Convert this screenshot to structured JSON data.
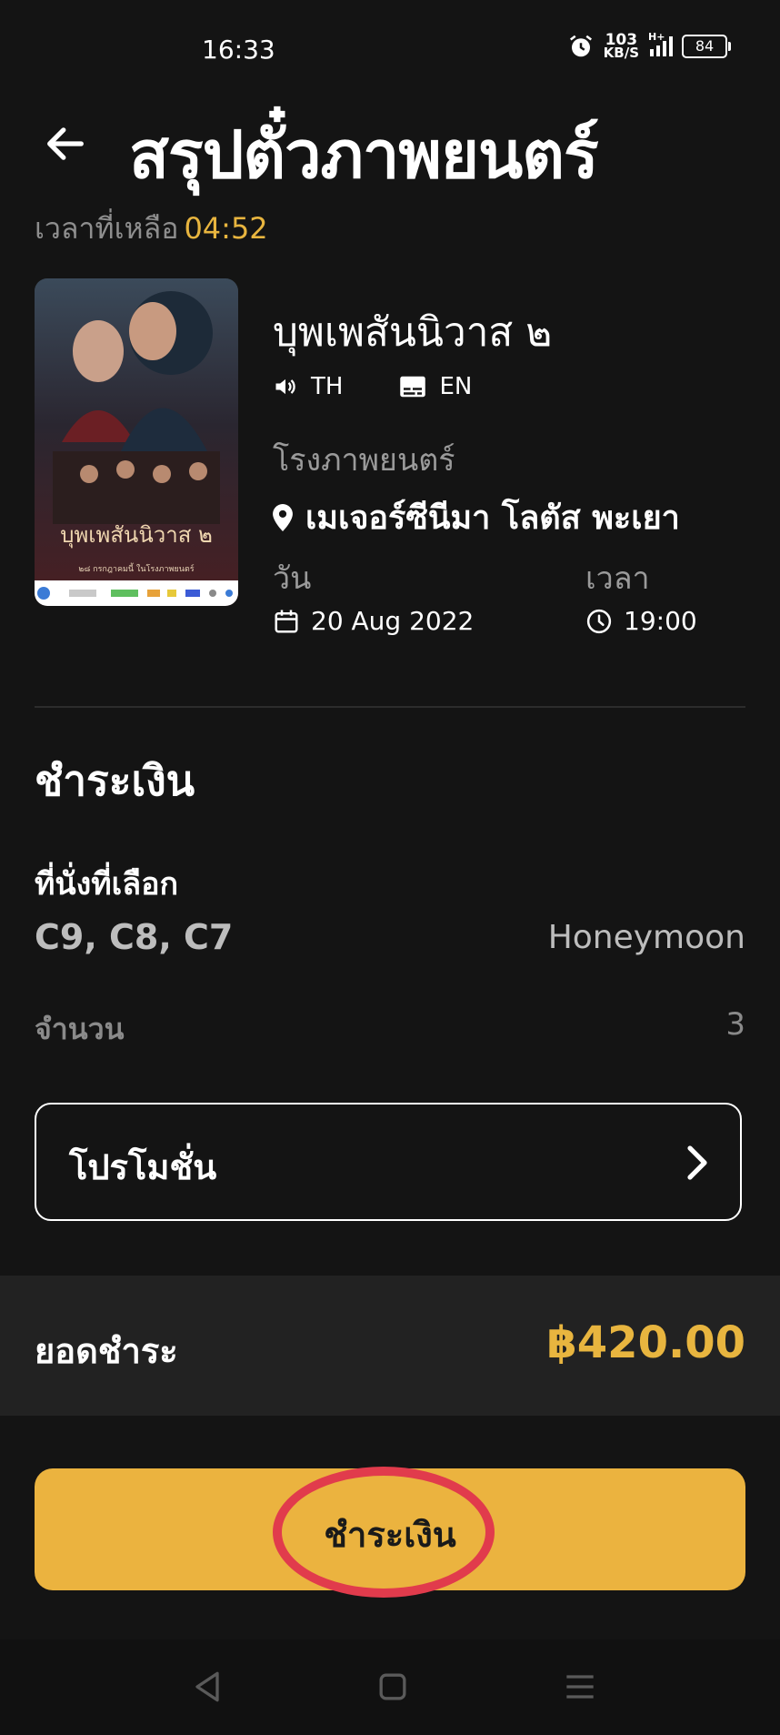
{
  "status_bar": {
    "time": "16:33",
    "speed_value": "103",
    "speed_unit": "KB/S",
    "network": "H+",
    "battery": "84"
  },
  "header": {
    "title": "สรุปตั๋วภาพยนตร์"
  },
  "timer": {
    "label": "เวลาที่เหลือ",
    "value": "04:52"
  },
  "movie": {
    "title": "บุพเพสันนิวาส ๒",
    "audio_language": "TH",
    "subtitle_language": "EN",
    "poster_title": "บุพเพสันนิวาส ๒",
    "poster_caption": "๒๘ กรกฎาคมนี้ ในโรงภาพยนตร์",
    "cinema_label": "โรงภาพยนตร์",
    "cinema_name": "เมเจอร์ซีนีมา โลตัส พะเยา",
    "date_label": "วัน",
    "date_value": "20 Aug 2022",
    "time_label": "เวลา",
    "time_value": "19:00"
  },
  "payment": {
    "section_title": "ชำระเงิน",
    "seats_label": "ที่นั่งที่เลือก",
    "seats_value": "C9, C8, C7",
    "seat_type": "Honeymoon",
    "quantity_label": "จำนวน",
    "quantity_value": "3",
    "promotion_label": "โปรโมชั่น",
    "total_label": "ยอดชำระ",
    "total_value": "฿420.00",
    "pay_button_label": "ชำระเงิน"
  },
  "colors": {
    "background": "#141414",
    "accent": "#ebb33f",
    "highlight_ring": "#e13b4c"
  },
  "icons": [
    "alarm-icon",
    "signal-icon",
    "battery-icon",
    "back-arrow-icon",
    "speaker-icon",
    "subtitle-icon",
    "location-pin-icon",
    "calendar-icon",
    "clock-icon",
    "chevron-right-icon",
    "nav-back-icon",
    "nav-home-icon",
    "nav-menu-icon"
  ]
}
